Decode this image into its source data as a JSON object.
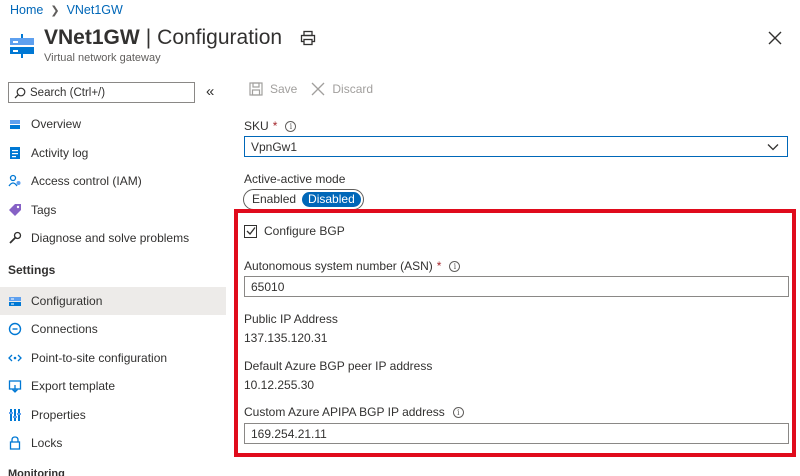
{
  "breadcrumb": {
    "home": "Home",
    "current": "VNet1GW"
  },
  "header": {
    "resource_name": "VNet1GW",
    "separator": "|",
    "section": "Configuration",
    "subtitle": "Virtual network gateway"
  },
  "search": {
    "placeholder": "Search (Ctrl+/)"
  },
  "sidebar": {
    "items": [
      {
        "label": "Overview",
        "icon": "overview-icon"
      },
      {
        "label": "Activity log",
        "icon": "activity-log-icon"
      },
      {
        "label": "Access control (IAM)",
        "icon": "iam-icon"
      },
      {
        "label": "Tags",
        "icon": "tag-icon"
      },
      {
        "label": "Diagnose and solve problems",
        "icon": "wrench-icon"
      }
    ],
    "section_settings": "Settings",
    "settings_items": [
      {
        "label": "Configuration",
        "icon": "configuration-icon",
        "selected": true
      },
      {
        "label": "Connections",
        "icon": "connections-icon"
      },
      {
        "label": "Point-to-site configuration",
        "icon": "point-to-site-icon"
      },
      {
        "label": "Export template",
        "icon": "export-template-icon"
      },
      {
        "label": "Properties",
        "icon": "properties-icon"
      },
      {
        "label": "Locks",
        "icon": "lock-icon"
      }
    ],
    "section_monitoring_partial": "Monitoring"
  },
  "toolbar": {
    "save": "Save",
    "discard": "Discard"
  },
  "form": {
    "sku_label": "SKU",
    "required_mark": "*",
    "sku_value": "VpnGw1",
    "active_active_label": "Active-active mode",
    "toggle_enabled": "Enabled",
    "toggle_disabled": "Disabled",
    "configure_bgp_label": "Configure BGP",
    "asn_label": "Autonomous system number (ASN)",
    "asn_value": "65010",
    "public_ip_label": "Public IP Address",
    "public_ip_value": "137.135.120.31",
    "default_peer_label": "Default Azure BGP peer IP address",
    "default_peer_value": "10.12.255.30",
    "apipa_label": "Custom Azure APIPA BGP IP address",
    "apipa_value": "169.254.21.11"
  },
  "colors": {
    "accent": "#0067b8",
    "highlight_border": "#e00b1c",
    "selected_nav": "#edebe9"
  }
}
